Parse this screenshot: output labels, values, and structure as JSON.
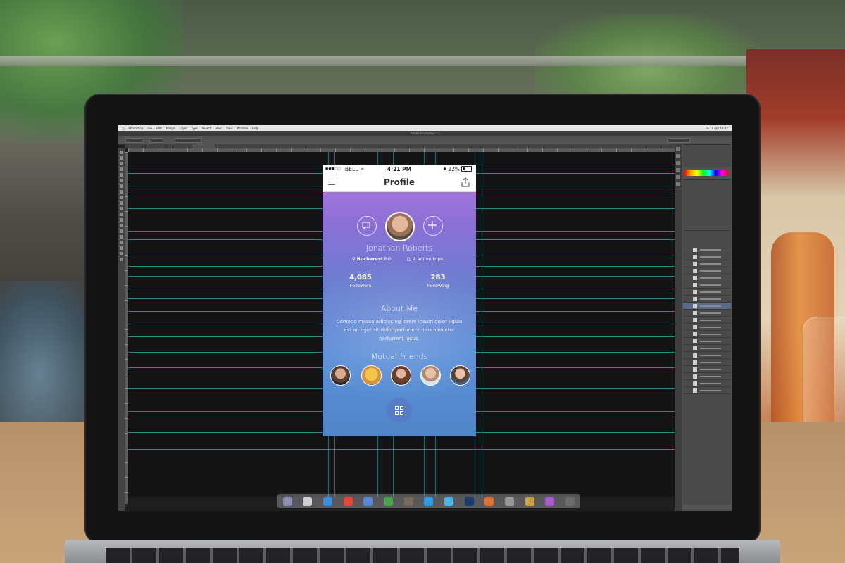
{
  "macos": {
    "app_menu": [
      "Photoshop",
      "File",
      "Edit",
      "Image",
      "Layer",
      "Type",
      "Select",
      "Filter",
      "View",
      "Window",
      "Help"
    ],
    "clock": "Fri 18 Apr 18:45"
  },
  "photoshop": {
    "window_title": "Adobe Photoshop CC",
    "doc_tabs": [],
    "layers": [],
    "colors": {
      "guide": "#2fb3b3",
      "panel": "#535353",
      "canvas": "#141414"
    }
  },
  "phone": {
    "status": {
      "carrier": "BELL",
      "time": "4:21 PM",
      "battery": "22%"
    },
    "nav": {
      "title": "Profile",
      "menu_icon": "hamburger-icon",
      "share_icon": "share-icon"
    },
    "profile": {
      "name": "Jonathan Roberts",
      "location": "Bucharest",
      "country": "RO",
      "trips_count": "2",
      "trips_label": "active trips",
      "followers_count": "4,085",
      "followers_label": "Followers",
      "following_count": "283",
      "following_label": "Following"
    },
    "about": {
      "title": "About Me",
      "body": "Comodo massa adipiscing lorem ipsum dolor ligula est an eget sit dolor parturient mus nascetur parturient lacus."
    },
    "mutual": {
      "title": "Mutual Friends",
      "count": 5
    },
    "colors": {
      "gradient_top": "#b37be0",
      "gradient_bottom": "#4f86c8"
    }
  }
}
